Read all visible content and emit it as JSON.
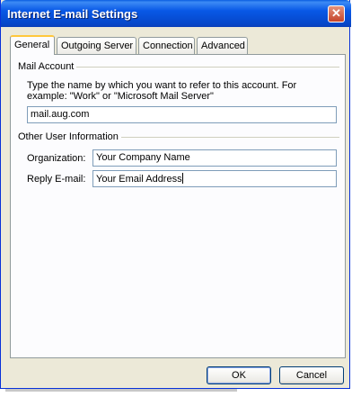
{
  "window": {
    "title": "Internet E-mail Settings"
  },
  "tabs": [
    {
      "label": "General",
      "active": true
    },
    {
      "label": "Outgoing Server",
      "active": false
    },
    {
      "label": "Connection",
      "active": false
    },
    {
      "label": "Advanced",
      "active": false
    }
  ],
  "mail_account": {
    "group_label": "Mail Account",
    "description": "Type the name by which you want to refer to this account. For example: \"Work\" or \"Microsoft Mail Server\"",
    "account_name": "mail.aug.com"
  },
  "user_info": {
    "group_label": "Other User Information",
    "organization_label": "Organization:",
    "organization_value": "Your Company Name",
    "reply_label": "Reply E-mail:",
    "reply_value": "Your Email Address"
  },
  "buttons": {
    "ok": "OK",
    "cancel": "Cancel"
  },
  "icons": {
    "close": "close-icon"
  }
}
